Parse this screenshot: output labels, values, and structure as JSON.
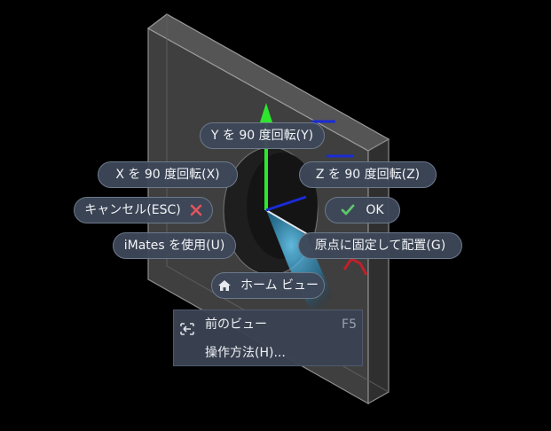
{
  "marking_menu": {
    "rotate_y": "Y を 90 度回転(Y)",
    "rotate_x": "X を 90 度回転(X)",
    "rotate_z": "Z を 90 度回転(Z)",
    "cancel": "キャンセル(ESC)",
    "ok": "OK",
    "imates": "iMates を使用(U)",
    "place_at_origin": "原点に固定して配置(G)",
    "home_view": "ホーム ビュー"
  },
  "context_menu": {
    "items": [
      {
        "label": "前のビュー",
        "shortcut": "F5",
        "icon": "previous-view-icon"
      },
      {
        "label": "操作方法(H)...",
        "shortcut": "",
        "icon": ""
      }
    ]
  },
  "icons": {
    "cancel": "close-x-icon",
    "ok": "checkmark-icon",
    "home": "home-icon"
  },
  "colors": {
    "background": "#000000",
    "pill_background": "#3e4858",
    "cancel_x": "#e2545c",
    "ok_check": "#5bc86a",
    "axis_y": "#2ee62e",
    "axis_z": "#1a2bd6",
    "axis_x": "#c0202a"
  }
}
